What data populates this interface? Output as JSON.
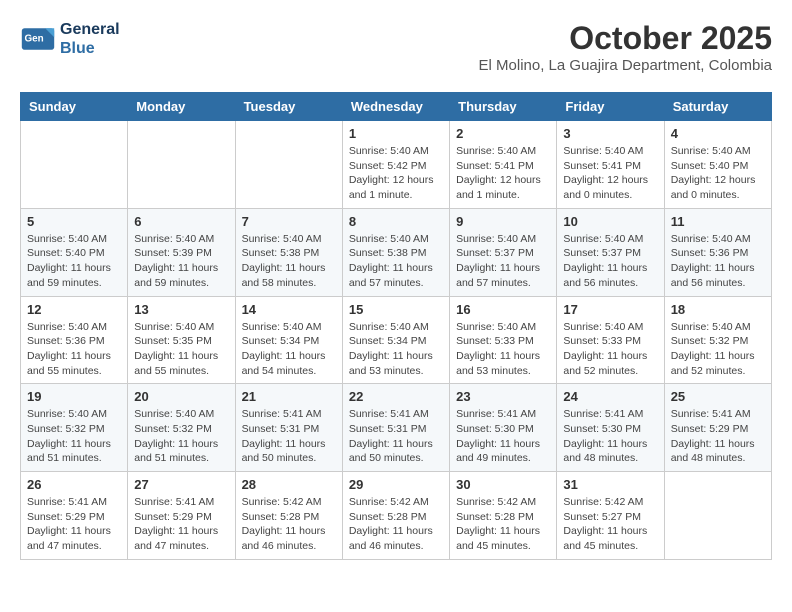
{
  "header": {
    "logo_line1": "General",
    "logo_line2": "Blue",
    "month_title": "October 2025",
    "subtitle": "El Molino, La Guajira Department, Colombia"
  },
  "weekdays": [
    "Sunday",
    "Monday",
    "Tuesday",
    "Wednesday",
    "Thursday",
    "Friday",
    "Saturday"
  ],
  "weeks": [
    [
      {
        "day": "",
        "info": ""
      },
      {
        "day": "",
        "info": ""
      },
      {
        "day": "",
        "info": ""
      },
      {
        "day": "1",
        "info": "Sunrise: 5:40 AM\nSunset: 5:42 PM\nDaylight: 12 hours\nand 1 minute."
      },
      {
        "day": "2",
        "info": "Sunrise: 5:40 AM\nSunset: 5:41 PM\nDaylight: 12 hours\nand 1 minute."
      },
      {
        "day": "3",
        "info": "Sunrise: 5:40 AM\nSunset: 5:41 PM\nDaylight: 12 hours\nand 0 minutes."
      },
      {
        "day": "4",
        "info": "Sunrise: 5:40 AM\nSunset: 5:40 PM\nDaylight: 12 hours\nand 0 minutes."
      }
    ],
    [
      {
        "day": "5",
        "info": "Sunrise: 5:40 AM\nSunset: 5:40 PM\nDaylight: 11 hours\nand 59 minutes."
      },
      {
        "day": "6",
        "info": "Sunrise: 5:40 AM\nSunset: 5:39 PM\nDaylight: 11 hours\nand 59 minutes."
      },
      {
        "day": "7",
        "info": "Sunrise: 5:40 AM\nSunset: 5:38 PM\nDaylight: 11 hours\nand 58 minutes."
      },
      {
        "day": "8",
        "info": "Sunrise: 5:40 AM\nSunset: 5:38 PM\nDaylight: 11 hours\nand 57 minutes."
      },
      {
        "day": "9",
        "info": "Sunrise: 5:40 AM\nSunset: 5:37 PM\nDaylight: 11 hours\nand 57 minutes."
      },
      {
        "day": "10",
        "info": "Sunrise: 5:40 AM\nSunset: 5:37 PM\nDaylight: 11 hours\nand 56 minutes."
      },
      {
        "day": "11",
        "info": "Sunrise: 5:40 AM\nSunset: 5:36 PM\nDaylight: 11 hours\nand 56 minutes."
      }
    ],
    [
      {
        "day": "12",
        "info": "Sunrise: 5:40 AM\nSunset: 5:36 PM\nDaylight: 11 hours\nand 55 minutes."
      },
      {
        "day": "13",
        "info": "Sunrise: 5:40 AM\nSunset: 5:35 PM\nDaylight: 11 hours\nand 55 minutes."
      },
      {
        "day": "14",
        "info": "Sunrise: 5:40 AM\nSunset: 5:34 PM\nDaylight: 11 hours\nand 54 minutes."
      },
      {
        "day": "15",
        "info": "Sunrise: 5:40 AM\nSunset: 5:34 PM\nDaylight: 11 hours\nand 53 minutes."
      },
      {
        "day": "16",
        "info": "Sunrise: 5:40 AM\nSunset: 5:33 PM\nDaylight: 11 hours\nand 53 minutes."
      },
      {
        "day": "17",
        "info": "Sunrise: 5:40 AM\nSunset: 5:33 PM\nDaylight: 11 hours\nand 52 minutes."
      },
      {
        "day": "18",
        "info": "Sunrise: 5:40 AM\nSunset: 5:32 PM\nDaylight: 11 hours\nand 52 minutes."
      }
    ],
    [
      {
        "day": "19",
        "info": "Sunrise: 5:40 AM\nSunset: 5:32 PM\nDaylight: 11 hours\nand 51 minutes."
      },
      {
        "day": "20",
        "info": "Sunrise: 5:40 AM\nSunset: 5:32 PM\nDaylight: 11 hours\nand 51 minutes."
      },
      {
        "day": "21",
        "info": "Sunrise: 5:41 AM\nSunset: 5:31 PM\nDaylight: 11 hours\nand 50 minutes."
      },
      {
        "day": "22",
        "info": "Sunrise: 5:41 AM\nSunset: 5:31 PM\nDaylight: 11 hours\nand 50 minutes."
      },
      {
        "day": "23",
        "info": "Sunrise: 5:41 AM\nSunset: 5:30 PM\nDaylight: 11 hours\nand 49 minutes."
      },
      {
        "day": "24",
        "info": "Sunrise: 5:41 AM\nSunset: 5:30 PM\nDaylight: 11 hours\nand 48 minutes."
      },
      {
        "day": "25",
        "info": "Sunrise: 5:41 AM\nSunset: 5:29 PM\nDaylight: 11 hours\nand 48 minutes."
      }
    ],
    [
      {
        "day": "26",
        "info": "Sunrise: 5:41 AM\nSunset: 5:29 PM\nDaylight: 11 hours\nand 47 minutes."
      },
      {
        "day": "27",
        "info": "Sunrise: 5:41 AM\nSunset: 5:29 PM\nDaylight: 11 hours\nand 47 minutes."
      },
      {
        "day": "28",
        "info": "Sunrise: 5:42 AM\nSunset: 5:28 PM\nDaylight: 11 hours\nand 46 minutes."
      },
      {
        "day": "29",
        "info": "Sunrise: 5:42 AM\nSunset: 5:28 PM\nDaylight: 11 hours\nand 46 minutes."
      },
      {
        "day": "30",
        "info": "Sunrise: 5:42 AM\nSunset: 5:28 PM\nDaylight: 11 hours\nand 45 minutes."
      },
      {
        "day": "31",
        "info": "Sunrise: 5:42 AM\nSunset: 5:27 PM\nDaylight: 11 hours\nand 45 minutes."
      },
      {
        "day": "",
        "info": ""
      }
    ]
  ]
}
